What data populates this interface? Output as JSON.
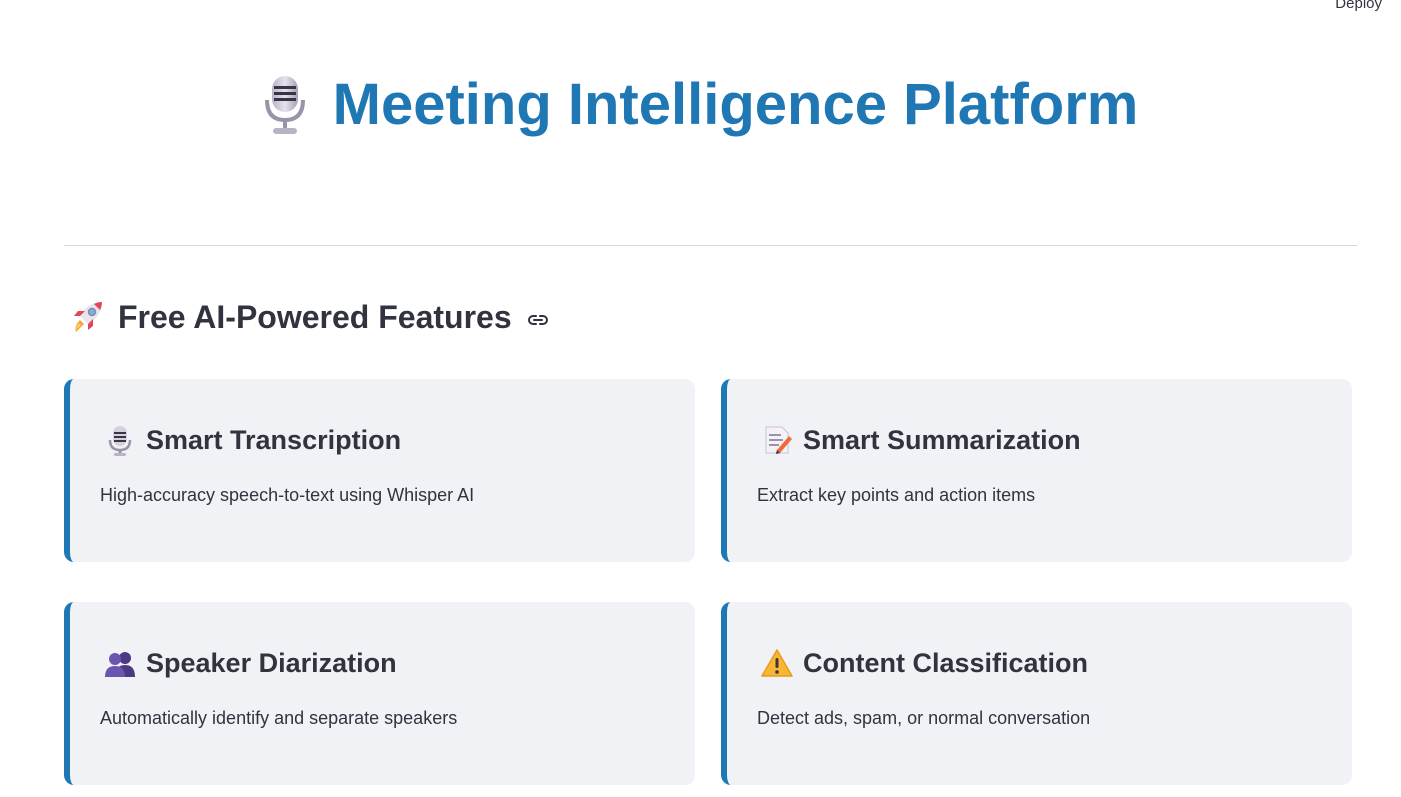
{
  "header": {
    "deploy_label": "Deploy"
  },
  "hero": {
    "icon": "microphone-icon",
    "title": "Meeting Intelligence Platform",
    "title_color": "#1f77b4"
  },
  "features_section": {
    "icon": "rocket-icon",
    "title": "Free AI-Powered Features",
    "link_icon": "link-icon"
  },
  "features": [
    {
      "icon": "microphone-icon",
      "title": "Smart Transcription",
      "description": "High-accuracy speech-to-text using Whisper AI"
    },
    {
      "icon": "memo-icon",
      "title": "Smart Summarization",
      "description": "Extract key points and action items"
    },
    {
      "icon": "people-icon",
      "title": "Speaker Diarization",
      "description": "Automatically identify and separate speakers"
    },
    {
      "icon": "warning-icon",
      "title": "Content Classification",
      "description": "Detect ads, spam, or normal conversation"
    }
  ],
  "colors": {
    "accent": "#1f77b4",
    "card_bg": "#f0f2f6",
    "text": "#31333f"
  }
}
